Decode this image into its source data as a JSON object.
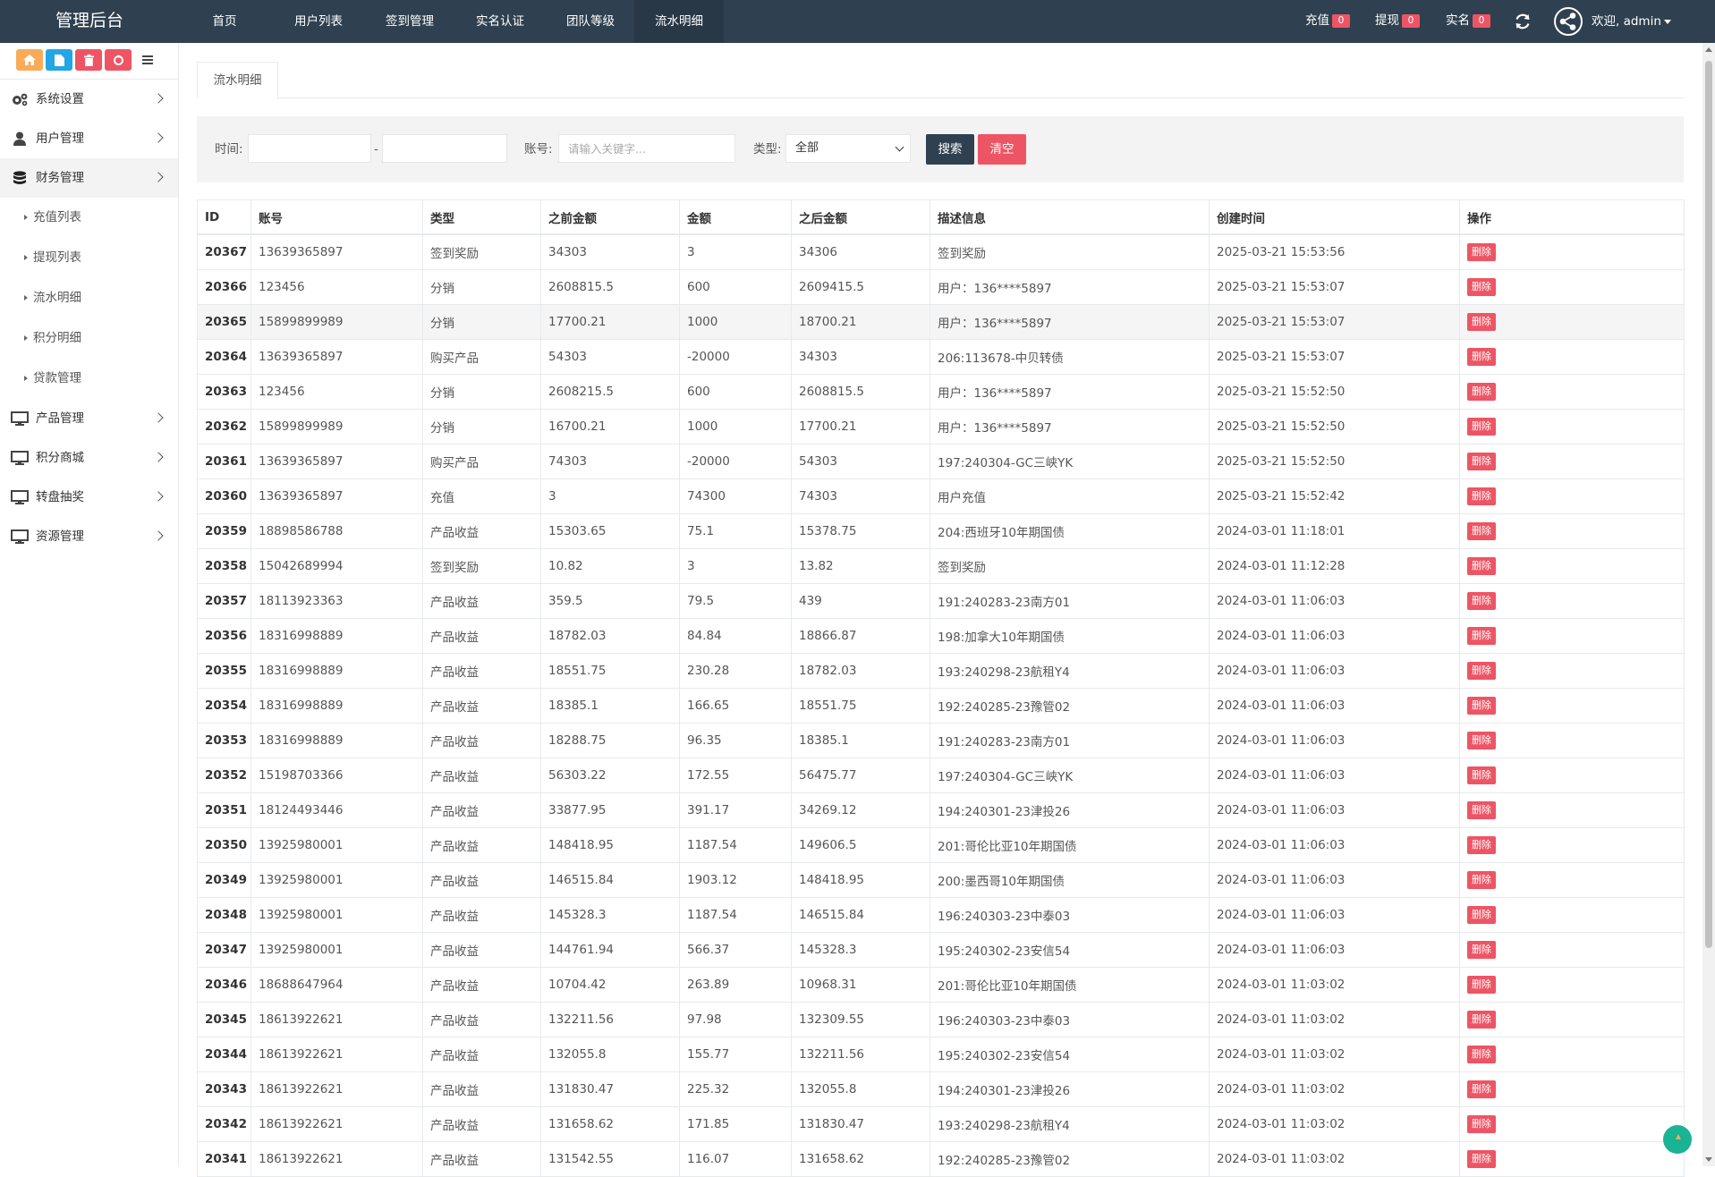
{
  "header": {
    "brand": "管理后台",
    "nav": [
      "首页",
      "用户列表",
      "签到管理",
      "实名认证",
      "团队等级",
      "流水明细"
    ],
    "counters": [
      {
        "label": "充值",
        "count": "0"
      },
      {
        "label": "提现",
        "count": "0"
      },
      {
        "label": "实名",
        "count": "0"
      }
    ],
    "user": "欢迎, admin"
  },
  "colors": {
    "topbar": "#2f4050",
    "danger": "#ed5565",
    "primary": "#2f4050",
    "accent": "#1ab394"
  },
  "sidebar": {
    "quick_icons": [
      "home-icon",
      "file-icon",
      "trash-icon",
      "recycle-icon",
      "list-icon"
    ],
    "menu": [
      {
        "label": "系统设置",
        "icon": "gears-icon"
      },
      {
        "label": "用户管理",
        "icon": "user-icon"
      },
      {
        "label": "财务管理",
        "icon": "database-icon"
      },
      {
        "label": "产品管理",
        "icon": "desktop-icon"
      },
      {
        "label": "积分商城",
        "icon": "desktop-icon"
      },
      {
        "label": "转盘抽奖",
        "icon": "desktop-icon"
      },
      {
        "label": "资源管理",
        "icon": "desktop-icon"
      }
    ],
    "finance_sub": [
      "充值列表",
      "提现列表",
      "流水明细",
      "积分明细",
      "贷款管理"
    ]
  },
  "page": {
    "tab": "流水明细"
  },
  "filters": {
    "time_label": "时间:",
    "time_sep": "-",
    "account_label": "账号:",
    "account_placeholder": "请输入关键字...",
    "type_label": "类型:",
    "type_value": "全部",
    "search": "搜索",
    "clear": "清空"
  },
  "table": {
    "columns": [
      "ID",
      "账号",
      "类型",
      "之前金额",
      "金额",
      "之后金额",
      "描述信息",
      "创建时间",
      "操作"
    ],
    "action_label": "删除",
    "rows": [
      [
        "20367",
        "13639365897",
        "签到奖励",
        "34303",
        "3",
        "34306",
        "签到奖励",
        "2025-03-21 15:53:56"
      ],
      [
        "20366",
        "123456",
        "分销",
        "2608815.5",
        "600",
        "2609415.5",
        "用户：136****5897",
        "2025-03-21 15:53:07"
      ],
      [
        "20365",
        "15899899989",
        "分销",
        "17700.21",
        "1000",
        "18700.21",
        "用户：136****5897",
        "2025-03-21 15:53:07"
      ],
      [
        "20364",
        "13639365897",
        "购买产品",
        "54303",
        "-20000",
        "34303",
        "206:113678-中贝转债",
        "2025-03-21 15:53:07"
      ],
      [
        "20363",
        "123456",
        "分销",
        "2608215.5",
        "600",
        "2608815.5",
        "用户：136****5897",
        "2025-03-21 15:52:50"
      ],
      [
        "20362",
        "15899899989",
        "分销",
        "16700.21",
        "1000",
        "17700.21",
        "用户：136****5897",
        "2025-03-21 15:52:50"
      ],
      [
        "20361",
        "13639365897",
        "购买产品",
        "74303",
        "-20000",
        "54303",
        "197:240304-GC三峡YK",
        "2025-03-21 15:52:50"
      ],
      [
        "20360",
        "13639365897",
        "充值",
        "3",
        "74300",
        "74303",
        "用户充值",
        "2025-03-21 15:52:42"
      ],
      [
        "20359",
        "18898586788",
        "产品收益",
        "15303.65",
        "75.1",
        "15378.75",
        "204:西班牙10年期国债",
        "2024-03-01 11:18:01"
      ],
      [
        "20358",
        "15042689994",
        "签到奖励",
        "10.82",
        "3",
        "13.82",
        "签到奖励",
        "2024-03-01 11:12:28"
      ],
      [
        "20357",
        "18113923363",
        "产品收益",
        "359.5",
        "79.5",
        "439",
        "191:240283-23南方01",
        "2024-03-01 11:06:03"
      ],
      [
        "20356",
        "18316998889",
        "产品收益",
        "18782.03",
        "84.84",
        "18866.87",
        "198:加拿大10年期国债",
        "2024-03-01 11:06:03"
      ],
      [
        "20355",
        "18316998889",
        "产品收益",
        "18551.75",
        "230.28",
        "18782.03",
        "193:240298-23航租Y4",
        "2024-03-01 11:06:03"
      ],
      [
        "20354",
        "18316998889",
        "产品收益",
        "18385.1",
        "166.65",
        "18551.75",
        "192:240285-23豫管02",
        "2024-03-01 11:06:03"
      ],
      [
        "20353",
        "18316998889",
        "产品收益",
        "18288.75",
        "96.35",
        "18385.1",
        "191:240283-23南方01",
        "2024-03-01 11:06:03"
      ],
      [
        "20352",
        "15198703366",
        "产品收益",
        "56303.22",
        "172.55",
        "56475.77",
        "197:240304-GC三峡YK",
        "2024-03-01 11:06:03"
      ],
      [
        "20351",
        "18124493446",
        "产品收益",
        "33877.95",
        "391.17",
        "34269.12",
        "194:240301-23津投26",
        "2024-03-01 11:06:03"
      ],
      [
        "20350",
        "13925980001",
        "产品收益",
        "148418.95",
        "1187.54",
        "149606.5",
        "201:哥伦比亚10年期国债",
        "2024-03-01 11:06:03"
      ],
      [
        "20349",
        "13925980001",
        "产品收益",
        "146515.84",
        "1903.12",
        "148418.95",
        "200:墨西哥10年期国债",
        "2024-03-01 11:06:03"
      ],
      [
        "20348",
        "13925980001",
        "产品收益",
        "145328.3",
        "1187.54",
        "146515.84",
        "196:240303-23中泰03",
        "2024-03-01 11:06:03"
      ],
      [
        "20347",
        "13925980001",
        "产品收益",
        "144761.94",
        "566.37",
        "145328.3",
        "195:240302-23安信54",
        "2024-03-01 11:06:03"
      ],
      [
        "20346",
        "18688647964",
        "产品收益",
        "10704.42",
        "263.89",
        "10968.31",
        "201:哥伦比亚10年期国债",
        "2024-03-01 11:03:02"
      ],
      [
        "20345",
        "18613922621",
        "产品收益",
        "132211.56",
        "97.98",
        "132309.55",
        "196:240303-23中泰03",
        "2024-03-01 11:03:02"
      ],
      [
        "20344",
        "18613922621",
        "产品收益",
        "132055.8",
        "155.77",
        "132211.56",
        "195:240302-23安信54",
        "2024-03-01 11:03:02"
      ],
      [
        "20343",
        "18613922621",
        "产品收益",
        "131830.47",
        "225.32",
        "132055.8",
        "194:240301-23津投26",
        "2024-03-01 11:03:02"
      ],
      [
        "20342",
        "18613922621",
        "产品收益",
        "131658.62",
        "171.85",
        "131830.47",
        "193:240298-23航租Y4",
        "2024-03-01 11:03:02"
      ],
      [
        "20341",
        "18613922621",
        "产品收益",
        "131542.55",
        "116.07",
        "131658.62",
        "192:240285-23豫管02",
        "2024-03-01 11:03:02"
      ]
    ]
  }
}
